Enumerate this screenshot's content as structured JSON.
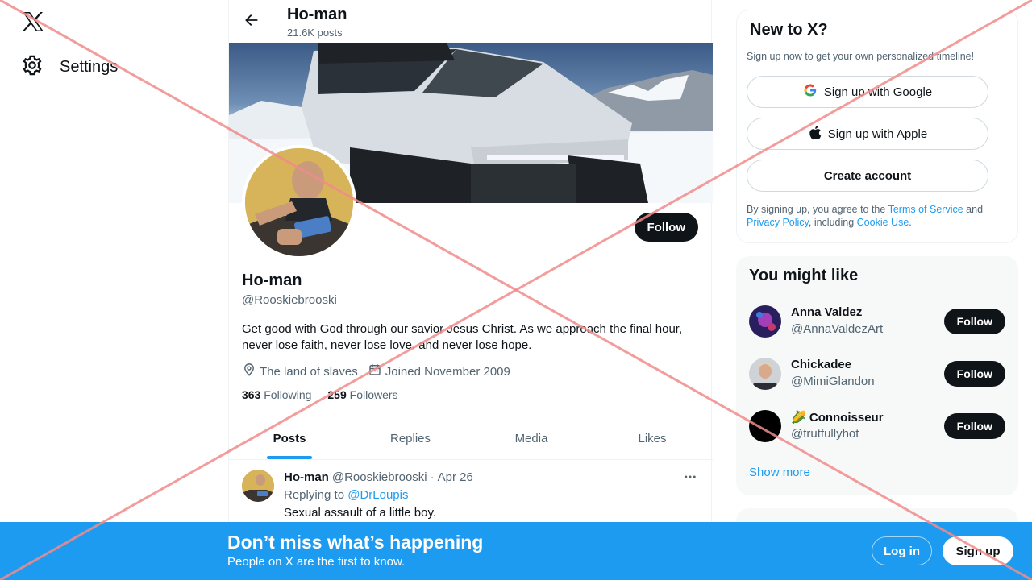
{
  "colors": {
    "accent": "#1d9bf0",
    "text_primary": "#0f1419",
    "text_secondary": "#536471",
    "button_dark": "#0f1419",
    "overlay_red": "#f28b8b"
  },
  "leftnav": {
    "logo_icon": "x-logo-icon",
    "settings_label": "Settings",
    "settings_icon": "gear-icon"
  },
  "header": {
    "title": "Ho-man",
    "posts_count": "21.6K posts",
    "back_icon": "arrow-left-icon"
  },
  "profile": {
    "follow_label": "Follow",
    "name": "Ho-man",
    "handle": "@Rooskiebrooski",
    "bio": "Get good with God through our savior Jesus Christ. As we approach the final hour, never lose faith, never lose love, and never lose hope.",
    "location": "The land of slaves",
    "joined": "Joined November 2009",
    "following_count": "363",
    "following_label": "Following",
    "followers_count": "259",
    "followers_label": "Followers"
  },
  "tabs": [
    {
      "label": "Posts",
      "active": true
    },
    {
      "label": "Replies",
      "active": false
    },
    {
      "label": "Media",
      "active": false
    },
    {
      "label": "Likes",
      "active": false
    }
  ],
  "tweet": {
    "name": "Ho-man",
    "handle": "@Rooskiebrooski",
    "separator": "·",
    "date": "Apr 26",
    "replying_prefix": "Replying to",
    "replying_to": "@DrLoupis",
    "text": "Sexual assault of a little boy.",
    "more_icon": "more-horizontal-icon"
  },
  "signup_card": {
    "title": "New to X?",
    "subtitle": "Sign up now to get your own personalized timeline!",
    "google_label": "Sign up with Google",
    "apple_label": "Sign up with Apple",
    "create_label": "Create account",
    "legal_prefix": "By signing up, you agree to the",
    "terms": "Terms of Service",
    "and": "and",
    "privacy": "Privacy Policy",
    "including": ", including",
    "cookie": "Cookie Use",
    "period": "."
  },
  "suggestions": {
    "title": "You might like",
    "items": [
      {
        "name": "Anna Valdez",
        "handle": "@AnnaValdezArt",
        "follow": "Follow"
      },
      {
        "name": "Chickadee",
        "handle": "@MimiGlandon",
        "follow": "Follow"
      },
      {
        "name": "Connoisseur",
        "emoji": "🌽",
        "handle": "@trutfullyhot",
        "follow": "Follow"
      }
    ],
    "show_more": "Show more"
  },
  "bottom_banner": {
    "title": "Don’t miss what’s happening",
    "subtitle": "People on X are the first to know.",
    "login": "Log in",
    "signup": "Sign up"
  }
}
